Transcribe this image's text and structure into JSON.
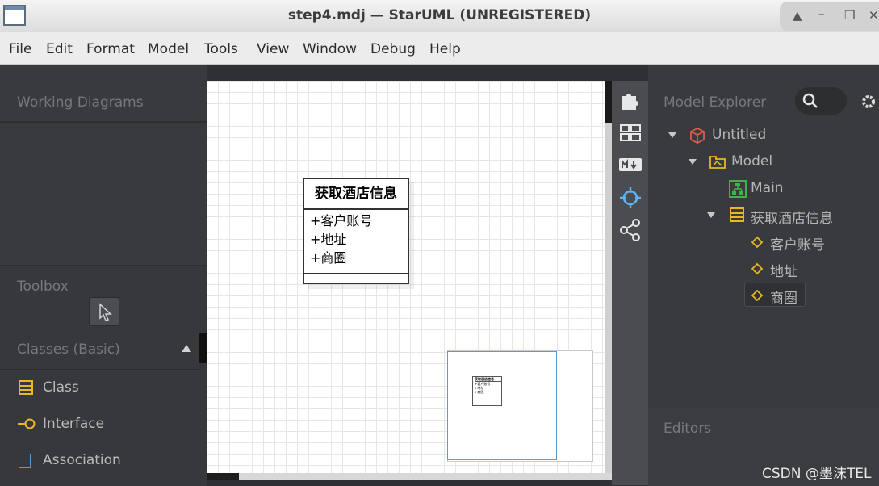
{
  "window": {
    "title": "step4.mdj — StarUML (UNREGISTERED)",
    "controls": [
      "restore-icon",
      "minimize-icon",
      "maximize-icon",
      "close-icon"
    ]
  },
  "menu": [
    "File",
    "Edit",
    "Format",
    "Model",
    "Tools",
    "View",
    "Window",
    "Debug",
    "Help"
  ],
  "left_panel": {
    "working_diagrams_title": "Working Diagrams",
    "toolbox_title": "Toolbox",
    "classes_group": "Classes (Basic)",
    "tools": [
      {
        "label": "Class",
        "icon": "class-icon"
      },
      {
        "label": "Interface",
        "icon": "interface-icon"
      },
      {
        "label": "Association",
        "icon": "association-icon"
      }
    ]
  },
  "diagram": {
    "class": {
      "name": "获取酒店信息",
      "attributes": [
        "+客户账号",
        "+地址",
        "+商圈"
      ]
    },
    "minimap_class": {
      "name": "获取酒店信息",
      "attributes": [
        "+客户账号",
        "+地址",
        "+商圈"
      ]
    }
  },
  "sidebar_icons": [
    "extensions-icon",
    "layout-icon",
    "markdown-icon",
    "crosshair-icon",
    "share-icon"
  ],
  "model_explorer": {
    "title": "Model Explorer",
    "tree": {
      "root": "Untitled",
      "model": "Model",
      "diagram": "Main",
      "class": "获取酒店信息",
      "attributes": [
        "客户账号",
        "地址",
        "商圈"
      ]
    },
    "editors_title": "Editors"
  },
  "colors": {
    "title_bg": "#e4e4e4",
    "panel_bg": "#383a3d",
    "accent_yellow": "#e8b923",
    "diagram_green": "#3cb44a",
    "root_red": "#d9534f",
    "selection_blue": "#5b9bd5"
  },
  "watermark": "CSDN @墨沫TEL"
}
